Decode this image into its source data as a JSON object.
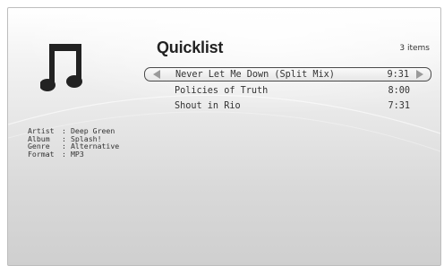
{
  "quicklist": {
    "title": "Quicklist",
    "count_label": "3 items",
    "tracks": [
      {
        "title": "Never Let Me Down (Split Mix)",
        "duration": "9:31",
        "selected": true
      },
      {
        "title": "Policies of Truth",
        "duration": "8:00",
        "selected": false
      },
      {
        "title": "Shout in Rio",
        "duration": "7:31",
        "selected": false
      }
    ]
  },
  "metadata": [
    {
      "key": "Artist",
      "value": "Deep Green"
    },
    {
      "key": "Album",
      "value": "Splash!"
    },
    {
      "key": "Genre",
      "value": "Alternative"
    },
    {
      "key": "Format",
      "value": "MP3"
    }
  ],
  "icons": {
    "media_type": "music-note-icon",
    "prev": "arrow-left-icon",
    "next": "arrow-right-icon"
  },
  "colors": {
    "text": "#333333",
    "selection_border": "#4a4a4a",
    "arrow": "#9a9a9a"
  }
}
